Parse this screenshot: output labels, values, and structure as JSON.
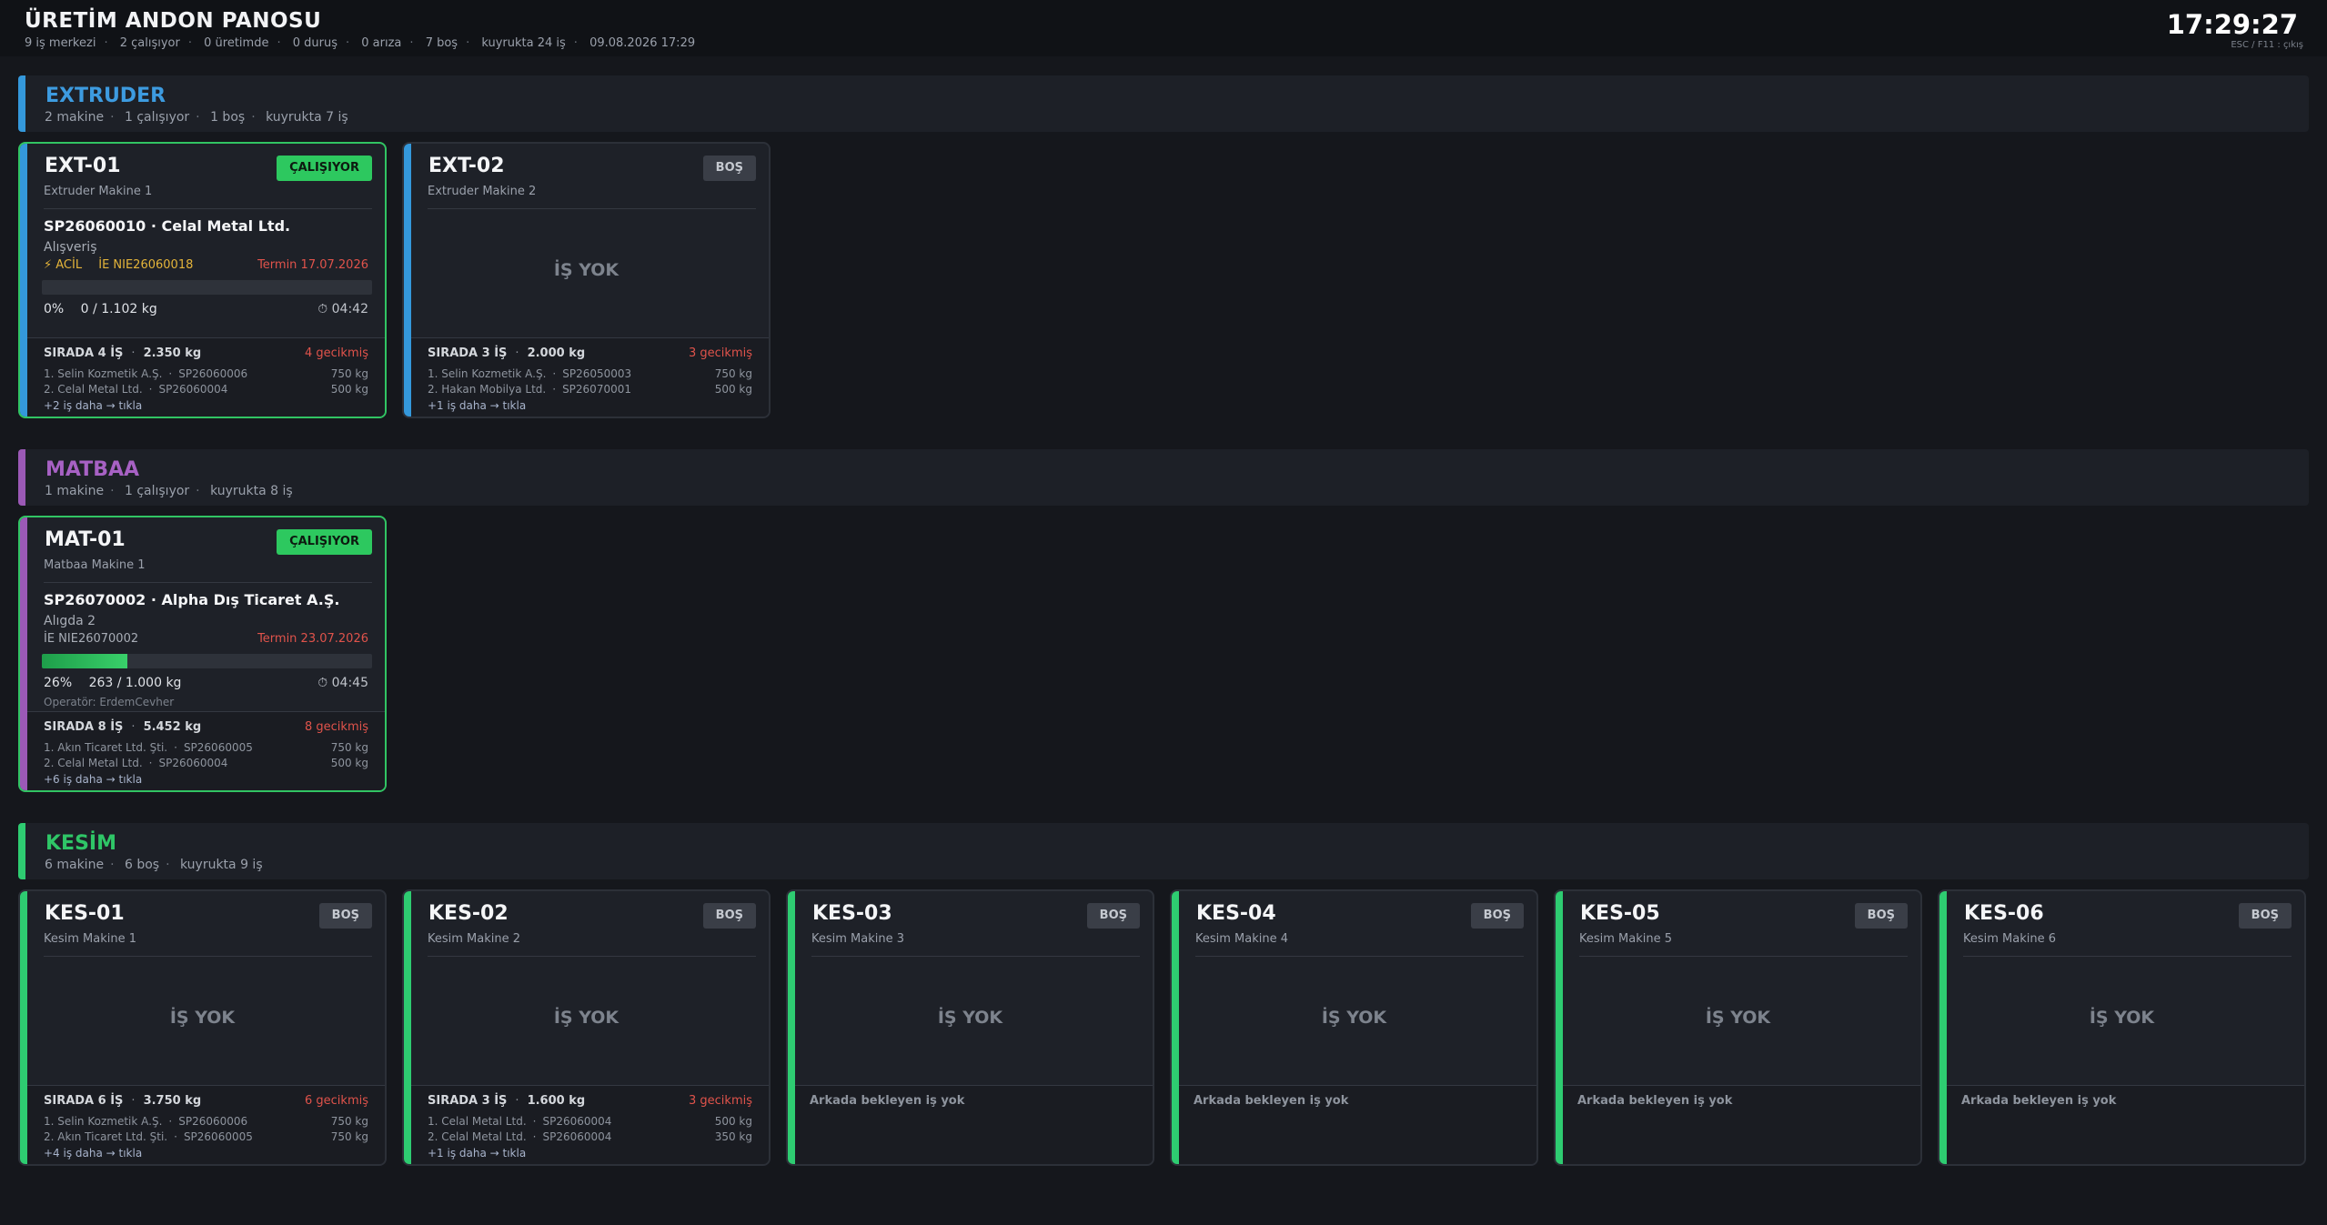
{
  "header": {
    "title": "ÜRETİM ANDON PANOSU",
    "summary": [
      "9 iş merkezi",
      "2 çalışıyor",
      "0 üretimde",
      "0 duruş",
      "0 arıza",
      "7 boş",
      "kuyrukta 24 iş",
      "09.08.2026 17:29"
    ],
    "clock": "17:29:27",
    "hint": "ESC / F11 : çıkış"
  },
  "colors": {
    "extruder": "#3498db",
    "matbaa": "#9b59b6",
    "kesim": "#2ecc71",
    "running": "#2dc85f"
  },
  "groups": {
    "extruder": {
      "name": "EXTRUDER",
      "sub": [
        "2 makine",
        "1 çalışıyor",
        "1 boş",
        "kuyrukta 7 iş"
      ],
      "machines": [
        {
          "code": "EXT-01",
          "name": "Extruder Makine 1",
          "status": "ÇALIŞIYOR",
          "order": "SP26060010  ·  Celal Metal Ltd.",
          "product": "Alışveriş",
          "urgent": "⚡ ACİL",
          "ie": "İE NIE26060018",
          "termin": "Termin 17.07.2026",
          "progress": 0,
          "pct": "0%",
          "qty": "0 / 1.102 kg",
          "timer": "⏱ 04:42",
          "queue_head": "SIRADA 4 İŞ",
          "queue_kg": "2.350 kg",
          "late": "4 gecikmiş",
          "q1": "1. Selin Kozmetik A.Ş.",
          "q1_sp": "SP26060006",
          "q1_kg": "750 kg",
          "q2": "2. Celal Metal Ltd.",
          "q2_sp": "SP26060004",
          "q2_kg": "500 kg",
          "more": "+2 iş daha  →  tıkla"
        },
        {
          "code": "EXT-02",
          "name": "Extruder Makine 2",
          "status": "BOŞ",
          "no_job": "İŞ YOK",
          "queue_head": "SIRADA 3 İŞ",
          "queue_kg": "2.000 kg",
          "late": "3 gecikmiş",
          "q1": "1. Selin Kozmetik A.Ş.",
          "q1_sp": "SP26050003",
          "q1_kg": "750 kg",
          "q2": "2. Hakan Mobilya Ltd.",
          "q2_sp": "SP26070001",
          "q2_kg": "500 kg",
          "more": "+1 iş daha  →  tıkla"
        }
      ]
    },
    "matbaa": {
      "name": "MATBAA",
      "sub": [
        "1 makine",
        "1 çalışıyor",
        "kuyrukta 8 iş"
      ],
      "machines": [
        {
          "code": "MAT-01",
          "name": "Matbaa Makine 1",
          "status": "ÇALIŞIYOR",
          "order": "SP26070002  ·  Alpha Dış Ticaret A.Ş.",
          "product": "Alıgda 2",
          "ie": "İE NIE26070002",
          "termin": "Termin 23.07.2026",
          "progress": 26,
          "pct": "26%",
          "qty": "263 / 1.000 kg",
          "timer": "⏱ 04:45",
          "operator": "Operatör: ErdemCevher",
          "queue_head": "SIRADA 8 İŞ",
          "queue_kg": "5.452 kg",
          "late": "8 gecikmiş",
          "q1": "1. Akın Ticaret Ltd. Şti.",
          "q1_sp": "SP26060005",
          "q1_kg": "750 kg",
          "q2": "2. Celal Metal Ltd.",
          "q2_sp": "SP26060004",
          "q2_kg": "500 kg",
          "more": "+6 iş daha  →  tıkla"
        }
      ]
    },
    "kesim": {
      "name": "KESİM",
      "sub": [
        "6 makine",
        "6 boş",
        "kuyrukta 9 iş"
      ],
      "machines": [
        {
          "code": "KES-01",
          "name": "Kesim Makine 1",
          "status": "BOŞ",
          "no_job": "İŞ YOK",
          "queue_head": "SIRADA 6 İŞ",
          "queue_kg": "3.750 kg",
          "late": "6 gecikmiş",
          "q1": "1. Selin Kozmetik A.Ş.",
          "q1_sp": "SP26060006",
          "q1_kg": "750 kg",
          "q2": "2. Akın Ticaret Ltd. Şti.",
          "q2_sp": "SP26060005",
          "q2_kg": "750 kg",
          "more": "+4 iş daha  →  tıkla"
        },
        {
          "code": "KES-02",
          "name": "Kesim Makine 2",
          "status": "BOŞ",
          "no_job": "İŞ YOK",
          "queue_head": "SIRADA 3 İŞ",
          "queue_kg": "1.600 kg",
          "late": "3 gecikmiş",
          "q1": "1. Celal Metal Ltd.",
          "q1_sp": "SP26060004",
          "q1_kg": "500 kg",
          "q2": "2. Celal Metal Ltd.",
          "q2_sp": "SP26060004",
          "q2_kg": "350 kg",
          "more": "+1 iş daha  →  tıkla"
        },
        {
          "code": "KES-03",
          "name": "Kesim Makine 3",
          "status": "BOŞ",
          "no_job": "İŞ YOK",
          "empty_queue": "Arkada bekleyen iş yok"
        },
        {
          "code": "KES-04",
          "name": "Kesim Makine 4",
          "status": "BOŞ",
          "no_job": "İŞ YOK",
          "empty_queue": "Arkada bekleyen iş yok"
        },
        {
          "code": "KES-05",
          "name": "Kesim Makine 5",
          "status": "BOŞ",
          "no_job": "İŞ YOK",
          "empty_queue": "Arkada bekleyen iş yok"
        },
        {
          "code": "KES-06",
          "name": "Kesim Makine 6",
          "status": "BOŞ",
          "no_job": "İŞ YOK",
          "empty_queue": "Arkada bekleyen iş yok"
        }
      ]
    }
  }
}
